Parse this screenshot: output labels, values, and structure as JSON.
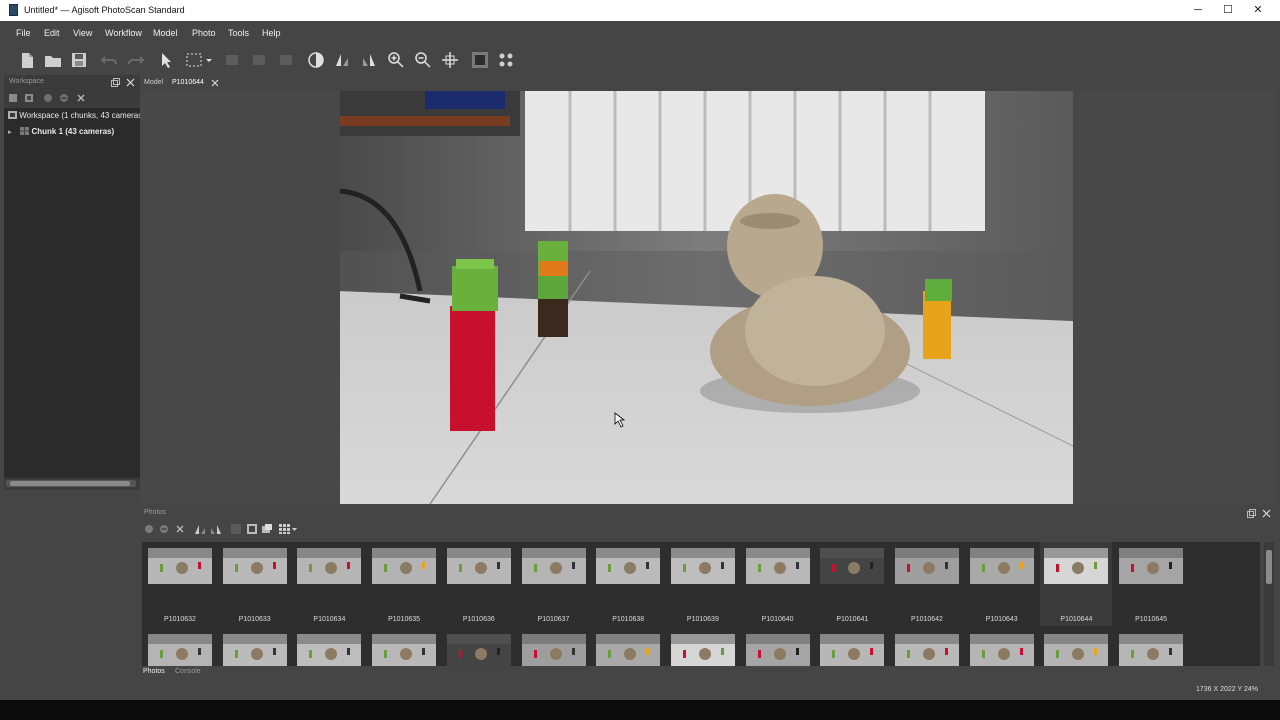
{
  "window": {
    "title": "Untitled* — Agisoft PhotoScan Standard",
    "controls": [
      "─",
      "☐",
      "✕"
    ]
  },
  "menu": [
    "File",
    "Edit",
    "View",
    "Workflow",
    "Model",
    "Photo",
    "Tools",
    "Help"
  ],
  "workspace": {
    "pane_title": "Workspace",
    "root_label": "Workspace (1 chunks, 43 cameras)",
    "chunk_label": "Chunk 1 (43 cameras)"
  },
  "viewer": {
    "tabs": [
      "Model",
      "P1010644"
    ]
  },
  "photos": {
    "pane_title": "Photos",
    "thumbnails": [
      {
        "label": "P1010632"
      },
      {
        "label": "P1010633"
      },
      {
        "label": "P1010634"
      },
      {
        "label": "P1010635"
      },
      {
        "label": "P1010636"
      },
      {
        "label": "P1010637"
      },
      {
        "label": "P1010638"
      },
      {
        "label": "P1010639"
      },
      {
        "label": "P1010640"
      },
      {
        "label": "P1010641"
      },
      {
        "label": "P1010642"
      },
      {
        "label": "P1010643"
      },
      {
        "label": "P1010644",
        "selected": true
      },
      {
        "label": "P1010645"
      }
    ],
    "bottom_tabs": [
      "Photos",
      "Console"
    ]
  },
  "status": "1736 X 2022 Y  24%",
  "colors": {
    "panel": "#454545",
    "tree_bg": "#2b2b2b",
    "text": "#e8e8e8"
  }
}
